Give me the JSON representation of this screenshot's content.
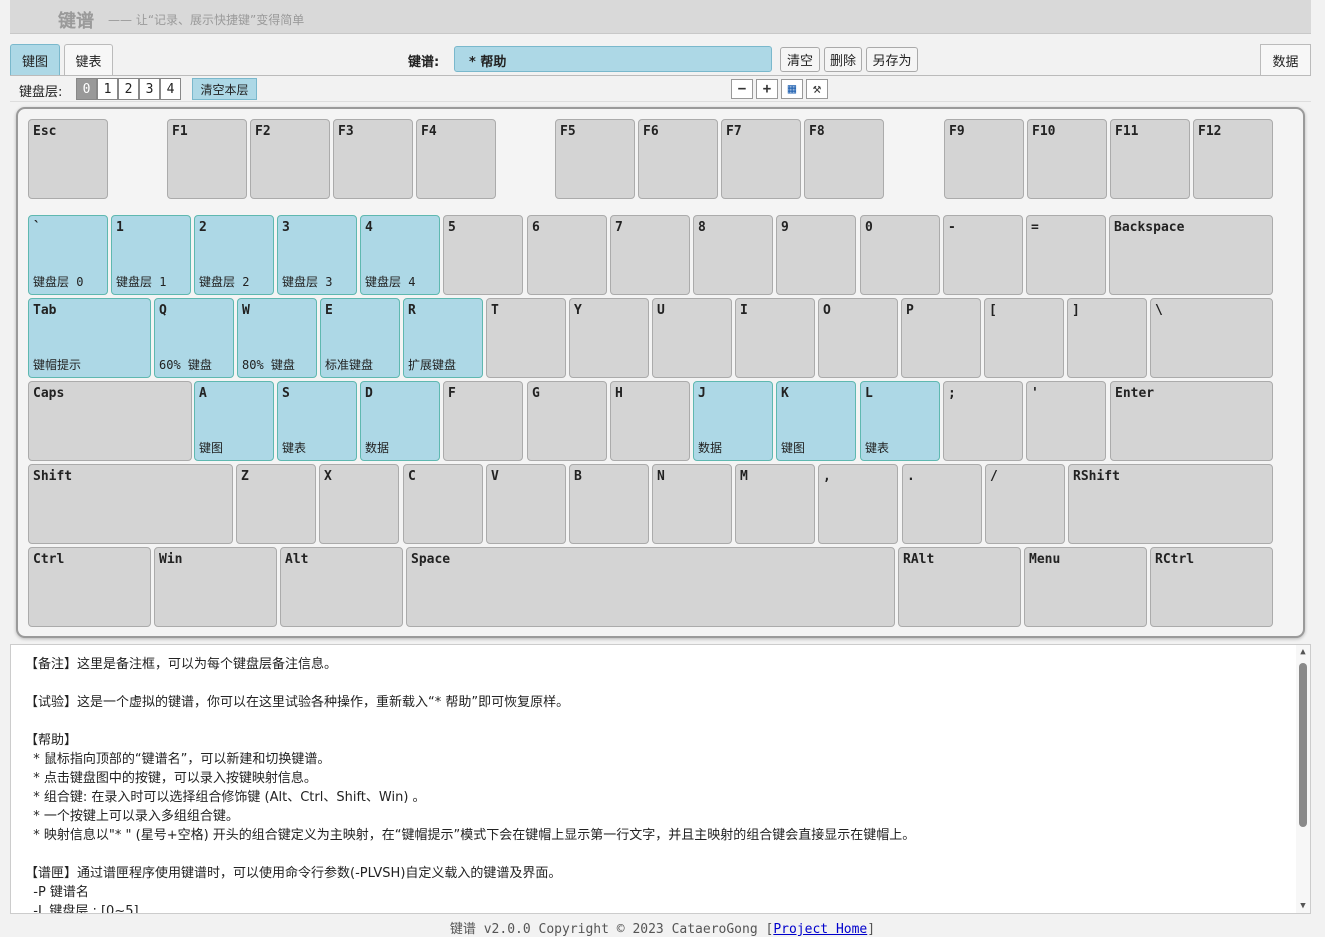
{
  "header": {
    "title": "键谱",
    "subtitle": "—— 让“记录、展示快捷键”变得简单"
  },
  "tabs": [
    {
      "label": "键图",
      "active": true
    },
    {
      "label": "键表",
      "active": false
    }
  ],
  "data_tab": "数据",
  "keymap": {
    "label": "键谱:",
    "name": "* 帮助",
    "buttons": {
      "clear": "清空",
      "delete": "删除",
      "save_as": "另存为"
    }
  },
  "layers": {
    "label": "键盘层:",
    "items": [
      "0",
      "1",
      "2",
      "3",
      "4"
    ],
    "selected": "0",
    "clear_label": "清空本层"
  },
  "tools": {
    "minus": "−",
    "plus": "+",
    "grid": "▦",
    "settings": "⚒"
  },
  "keyboard": {
    "highlight_color": "#add8e6",
    "rows": [
      [
        {
          "l": "Esc"
        },
        {
          "l": "F1"
        },
        {
          "l": "F2"
        },
        {
          "l": "F3"
        },
        {
          "l": "F4"
        },
        {
          "l": "F5"
        },
        {
          "l": "F6"
        },
        {
          "l": "F7"
        },
        {
          "l": "F8"
        },
        {
          "l": "F9"
        },
        {
          "l": "F10"
        },
        {
          "l": "F11"
        },
        {
          "l": "F12"
        }
      ],
      [
        {
          "l": "`",
          "s": "键盘层 0",
          "h": true
        },
        {
          "l": "1",
          "s": "键盘层 1",
          "h": true
        },
        {
          "l": "2",
          "s": "键盘层 2",
          "h": true
        },
        {
          "l": "3",
          "s": "键盘层 3",
          "h": true
        },
        {
          "l": "4",
          "s": "键盘层 4",
          "h": true
        },
        {
          "l": "5"
        },
        {
          "l": "6"
        },
        {
          "l": "7"
        },
        {
          "l": "8"
        },
        {
          "l": "9"
        },
        {
          "l": "0"
        },
        {
          "l": "-"
        },
        {
          "l": "="
        },
        {
          "l": "Backspace"
        }
      ],
      [
        {
          "l": "Tab",
          "s": "键帽提示",
          "h": true
        },
        {
          "l": "Q",
          "s": "60% 键盘",
          "h": true
        },
        {
          "l": "W",
          "s": "80% 键盘",
          "h": true
        },
        {
          "l": "E",
          "s": "标准键盘",
          "h": true
        },
        {
          "l": "R",
          "s": "扩展键盘",
          "h": true
        },
        {
          "l": "T"
        },
        {
          "l": "Y"
        },
        {
          "l": "U"
        },
        {
          "l": "I"
        },
        {
          "l": "O"
        },
        {
          "l": "P"
        },
        {
          "l": "["
        },
        {
          "l": "]"
        },
        {
          "l": "\\"
        }
      ],
      [
        {
          "l": "Caps"
        },
        {
          "l": "A",
          "s": "键图",
          "h": true
        },
        {
          "l": "S",
          "s": "键表",
          "h": true
        },
        {
          "l": "D",
          "s": "数据",
          "h": true
        },
        {
          "l": "F"
        },
        {
          "l": "G"
        },
        {
          "l": "H"
        },
        {
          "l": "J",
          "s": "数据",
          "h": true
        },
        {
          "l": "K",
          "s": "键图",
          "h": true
        },
        {
          "l": "L",
          "s": "键表",
          "h": true
        },
        {
          "l": ";"
        },
        {
          "l": "'"
        },
        {
          "l": "Enter"
        }
      ],
      [
        {
          "l": "Shift"
        },
        {
          "l": "Z"
        },
        {
          "l": "X"
        },
        {
          "l": "C"
        },
        {
          "l": "V"
        },
        {
          "l": "B"
        },
        {
          "l": "N"
        },
        {
          "l": "M"
        },
        {
          "l": ","
        },
        {
          "l": "."
        },
        {
          "l": "/"
        },
        {
          "l": "RShift"
        }
      ],
      [
        {
          "l": "Ctrl"
        },
        {
          "l": "Win"
        },
        {
          "l": "Alt"
        },
        {
          "l": "Space"
        },
        {
          "l": "RAlt"
        },
        {
          "l": "Menu"
        },
        {
          "l": "RCtrl"
        }
      ]
    ]
  },
  "notes": {
    "lines": [
      "【备注】这里是备注框，可以为每个键盘层备注信息。",
      "",
      "【试验】这是一个虚拟的键谱，你可以在这里试验各种操作，重新载入“* 帮助”即可恢复原样。",
      "",
      "【帮助】",
      "  * 鼠标指向顶部的“键谱名”，可以新建和切换键谱。",
      "  * 点击键盘图中的按键，可以录入按键映射信息。",
      "  * 组合键: 在录入时可以选择组合修饰键 (Alt、Ctrl、Shift、Win) 。",
      "  * 一个按键上可以录入多组组合键。",
      "  * 映射信息以\"* \" (星号+空格) 开头的组合键定义为主映射，在“键帽提示”模式下会在键帽上显示第一行文字，并且主映射的组合键会直接显示在键帽上。",
      "",
      "【谱匣】通过谱匣程序使用键谱时，可以使用命令行参数(-PLVSH)自定义载入的键谱及界面。",
      "  -P 键谱名",
      "  -L 键盘层 : [0~5]"
    ]
  },
  "footer": {
    "text": "键谱 v2.0.0 Copyright © 2023 CataeroGong [",
    "link": "Project Home",
    "close": "]"
  }
}
